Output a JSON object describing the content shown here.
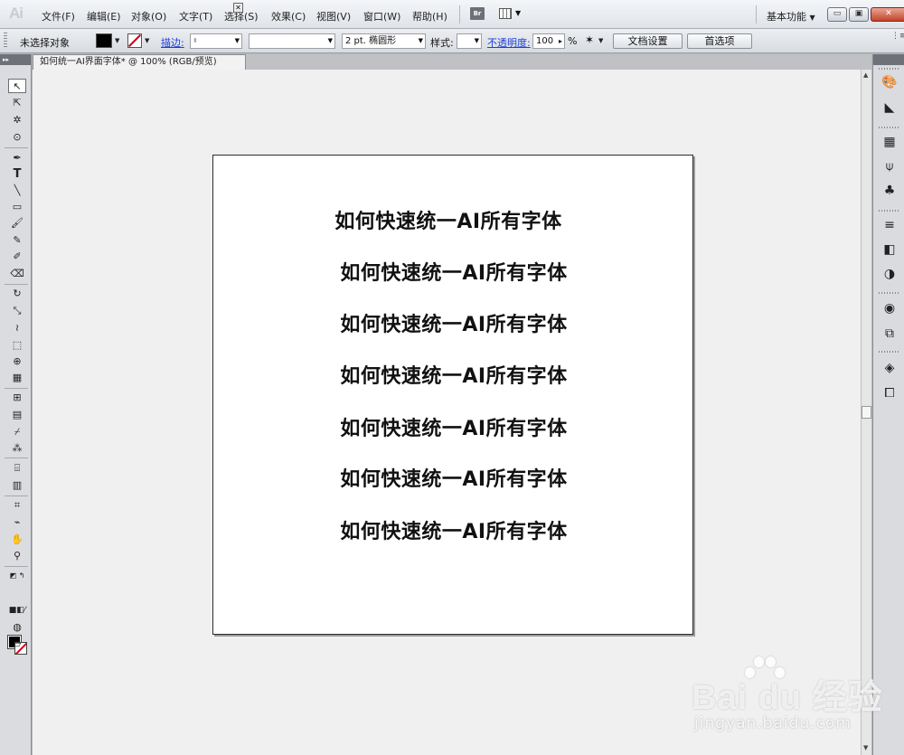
{
  "app": {
    "logo": "Ai"
  },
  "menu": {
    "items": [
      "文件(F)",
      "编辑(E)",
      "对象(O)",
      "文字(T)",
      "选择(S)",
      "效果(C)",
      "视图(V)",
      "窗口(W)",
      "帮助(H)"
    ],
    "bridge_label": "Br",
    "workspace": "基本功能"
  },
  "window_controls": {
    "minimize": "▭",
    "restore": "▣",
    "close": "✕"
  },
  "control_panel": {
    "selection_status": "未选择对象",
    "stroke_link": "描边:",
    "stroke_weight_value": "",
    "brush_value": "",
    "point_label": "2 pt. 椭圆形",
    "style_label": "样式:",
    "opacity_link": "不透明度:",
    "opacity_value": "100",
    "opacity_unit": "%",
    "document_setup": "文档设置",
    "preferences": "首选项"
  },
  "document": {
    "tab_title": "如何统一AI界面字体* @ 100% (RGB/预览)",
    "tab_close": "✕",
    "lines": [
      "如何快速统一AI所有字体",
      "如何快速统一AI所有字体",
      "如何快速统一AI所有字体",
      "如何快速统一AI所有字体",
      "如何快速统一AI所有字体",
      "如何快速统一AI所有字体",
      "如何快速统一AI所有字体"
    ]
  },
  "watermark": {
    "brand": "Bai du 经验",
    "url": "jingyan.baidu.com"
  },
  "colors": {
    "fill": "#000000",
    "stroke_none": "#d0001b",
    "link": "#1a3fd8"
  }
}
